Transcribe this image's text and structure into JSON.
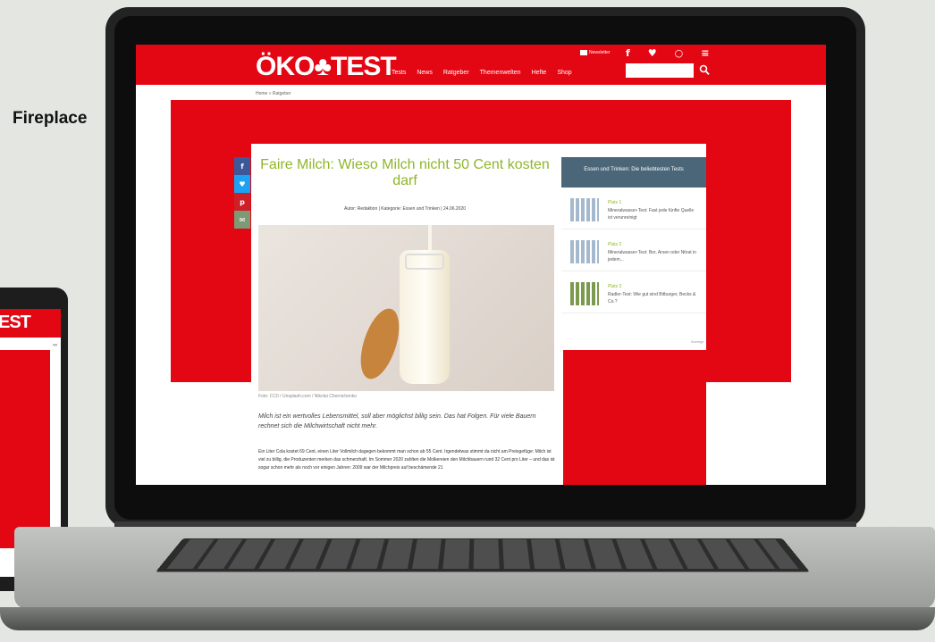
{
  "label": "Fireplace",
  "tablet": {
    "logo": "EST"
  },
  "site": {
    "logo": "ÖKO♣TEST",
    "nav": [
      "Tests",
      "News",
      "Ratgeber",
      "Themenwelten",
      "Hefte",
      "Shop"
    ],
    "newsletter": "Newsletter",
    "social": [
      "f",
      "♥",
      "○",
      "≡"
    ],
    "search": {
      "placeholder": "",
      "value": ""
    }
  },
  "breadcrumb": "Home » Ratgeber",
  "share": [
    "f",
    "♥",
    "p",
    "✉"
  ],
  "article": {
    "title": "Faire Milch: Wieso Milch nicht 50 Cent kosten darf",
    "meta": "Autor: Redaktion | Kategorie: Essen und Trinken | 24.06.2020",
    "caption": "Foto: CC0 / Unsplash.com / Nikolai Chernichenko",
    "lead": "Milch ist ein wertvolles Lebensmittel, soll aber möglichst billig sein. Das hat Folgen. Für viele Bauern rechnet sich die Milchwirtschaft nicht mehr.",
    "body": "Ein Liter Cola kostet 69 Cent, einen Liter Vollmilch dagegen bekommt man schon ab 55 Cent. Irgendetwas stimmt da nicht am Preisgefüge: Milch ist viel zu billig, die Produzenten merken das schmerzhaft. Im Sommer 2020 zahlten die Molkereien den Milchbauern rund 32 Cent pro Liter – und das ist sogar schon mehr als noch vor einigen Jahren: 2009 war der Milchpreis auf beschämende 21"
  },
  "sidebar": {
    "title": "Essen und Trinken: Die beliebtesten Tests",
    "items": [
      {
        "rank": "Platz 1",
        "text": "Mineralwasser-Test: Fast jede fünfte Quelle ist verunreinigt"
      },
      {
        "rank": "Platz 2",
        "text": "Mineralwasser-Test: Bor, Arsen oder Nitrat in jedem..."
      },
      {
        "rank": "Platz 3",
        "text": "Radler-Test: Wie gut sind Bitburger, Becks & Co.?"
      }
    ],
    "ad_label": "Anzeige"
  },
  "colors": {
    "brand_red": "#e30613",
    "accent_green": "#8fb62a",
    "sidebar_blue": "#4b6679"
  }
}
